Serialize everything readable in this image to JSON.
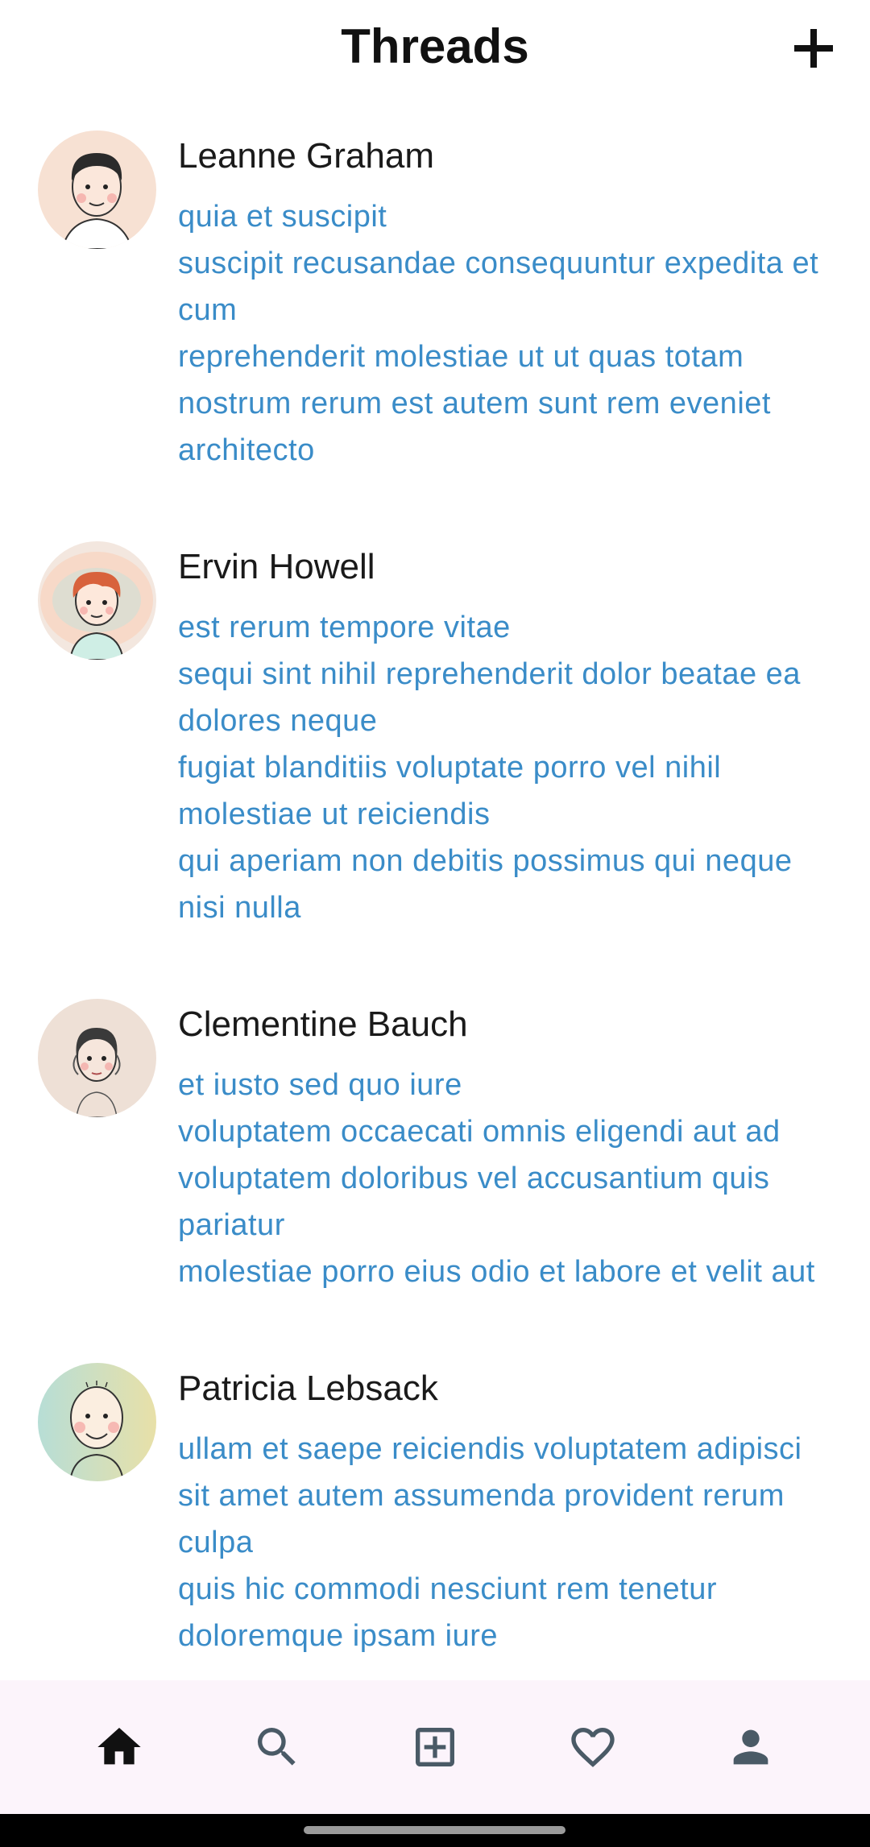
{
  "app": {
    "title": "Threads"
  },
  "colors": {
    "post_text": "#3a8cc8",
    "nav_background": "#fcf4fb",
    "nav_active": "#111111",
    "nav_inactive": "#4a5a66"
  },
  "threads": [
    {
      "author": "Leanne Graham",
      "avatar_icon": "avatar-man-short-hair",
      "posts": [
        "quia et suscipit",
        "suscipit recusandae consequuntur expedita et cum",
        "reprehenderit molestiae ut ut quas totam nostrum rerum est autem sunt rem eveniet architecto"
      ]
    },
    {
      "author": "Ervin Howell",
      "avatar_icon": "avatar-redhead",
      "posts": [
        "est rerum tempore vitae",
        "sequi sint nihil reprehenderit dolor beatae ea dolores neque",
        "fugiat blanditiis voluptate porro vel nihil molestiae ut reiciendis",
        "qui aperiam non debitis possimus qui neque nisi nulla"
      ]
    },
    {
      "author": "Clementine Bauch",
      "avatar_icon": "avatar-woman",
      "posts": [
        "et iusto sed quo iure",
        "voluptatem occaecati omnis eligendi aut ad voluptatem doloribus vel accusantium quis pariatur",
        "molestiae porro eius odio et labore et velit aut"
      ]
    },
    {
      "author": "Patricia Lebsack",
      "avatar_icon": "avatar-bald-smiling",
      "posts": [
        "ullam et saepe reiciendis voluptatem adipisci",
        "sit amet autem assumenda provident rerum culpa",
        "quis hic commodi nesciunt rem tenetur doloremque ipsam iure"
      ]
    }
  ],
  "bottom_nav": [
    {
      "icon": "home-icon",
      "active": true
    },
    {
      "icon": "search-icon",
      "active": false
    },
    {
      "icon": "add-box-icon",
      "active": false
    },
    {
      "icon": "heart-icon",
      "active": false
    },
    {
      "icon": "profile-icon",
      "active": false
    }
  ]
}
